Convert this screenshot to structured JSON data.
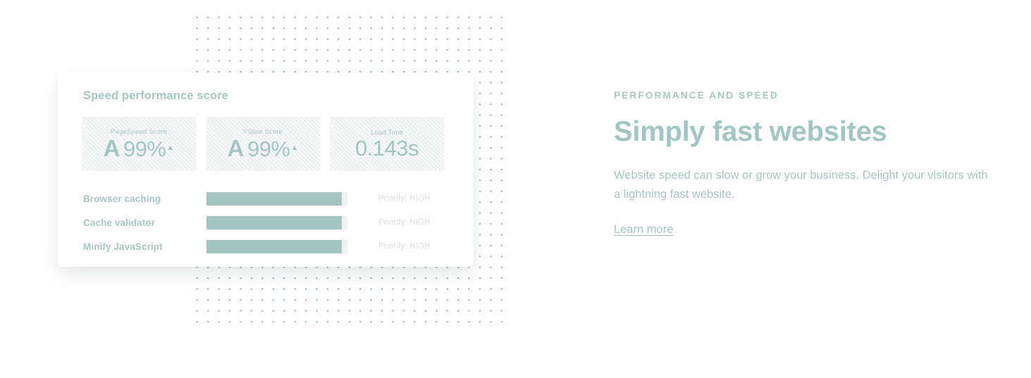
{
  "theme": {
    "accent": "#a3c5c3",
    "bar_fill": "#a3c4c0",
    "bar_track": "#f0f0f2",
    "muted_text": "#dadfe1",
    "dot_color": "#9fb6c4",
    "background": "#ffffff"
  },
  "card": {
    "title": "Speed performance score",
    "stats": [
      {
        "label": "PageSpeed Score",
        "grade": "A",
        "value": "99%",
        "trend_icon": "caret-up-icon",
        "trend": "▲"
      },
      {
        "label": "YSlow Score",
        "grade": "A",
        "value": "99%",
        "trend_icon": "caret-up-icon",
        "trend": "▲"
      },
      {
        "label": "Load Time",
        "grade": "",
        "value": "0.143s",
        "trend_icon": "",
        "trend": ""
      }
    ],
    "recommendations": [
      {
        "label": "Browser caching",
        "priority": "Priority: HIGH",
        "fill_percent": 96
      },
      {
        "label": "Cache validator",
        "priority": "Priority: HIGH",
        "fill_percent": 96
      },
      {
        "label": "Minify JavaScript",
        "priority": "Priority: HIGH",
        "fill_percent": 96
      }
    ]
  },
  "content": {
    "eyebrow": "PERFORMANCE AND SPEED",
    "headline": "Simply fast websites",
    "body": "Website speed can slow or grow your business. Delight your visitors with a lightning fast website.",
    "link_label": "Learn more"
  }
}
